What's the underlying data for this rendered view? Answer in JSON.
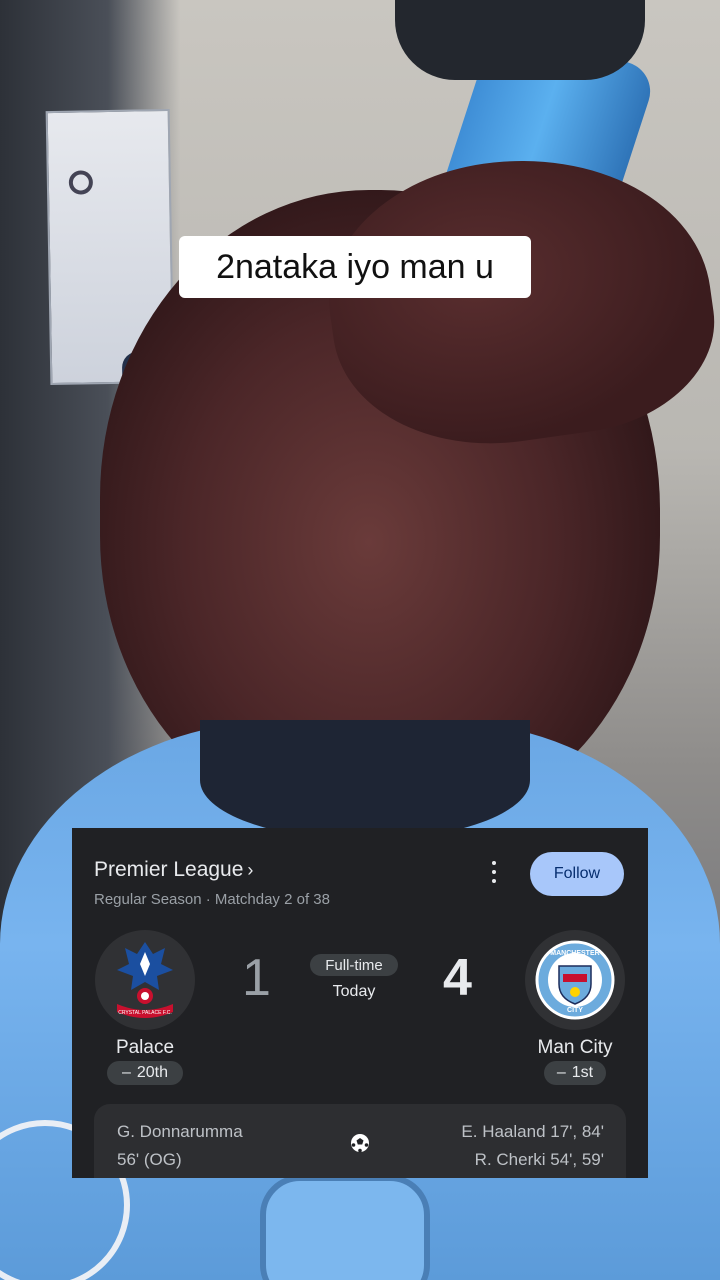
{
  "caption": {
    "text": "2nataka iyo man u"
  },
  "match": {
    "league_label": "Premier League",
    "chevron": "›",
    "season_info": "Regular Season · Matchday 2 of 38",
    "follow_label": "Follow",
    "status": "Full-time",
    "date": "Today",
    "home": {
      "name": "Palace",
      "score": "1",
      "rank_symbol": "–",
      "rank": "20th",
      "logo_icon": "crystal-palace-crest-icon",
      "scorers": [
        "G. Donnarumma",
        "56' (OG)"
      ]
    },
    "away": {
      "name": "Man City",
      "score": "4",
      "rank_symbol": "–",
      "rank": "1st",
      "logo_icon": "manchester-city-crest-icon",
      "scorers": [
        "E. Haaland 17', 84'",
        "R. Cherki 54', 59'"
      ]
    },
    "goal_icon": "soccer-ball-icon"
  },
  "colors": {
    "card_bg": "#202124",
    "follow_bg": "#a8c7fa",
    "pill_bg": "#3c4043"
  },
  "logo_text": {
    "home": "CRYSTAL PALACE F.C.",
    "away_top": "MANCHESTER",
    "away_bottom": "CITY"
  }
}
